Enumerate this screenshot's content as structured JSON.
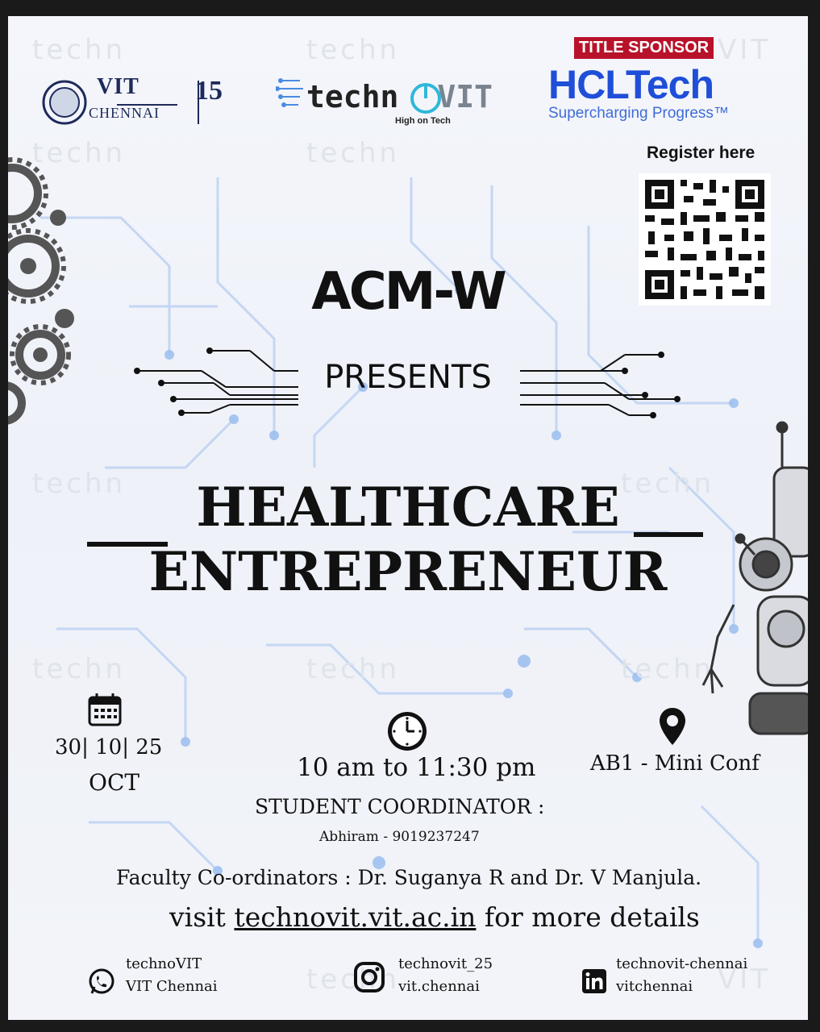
{
  "header": {
    "vit_name": "VIT",
    "vit_city": "CHENNAI",
    "vit_years": "15",
    "techno_brand": "techn",
    "techno_suffix": "VIT",
    "techno_tagline": "High on Tech",
    "watermark_text": "techn",
    "watermark_suffix": "VIT",
    "sponsor_label": "TITLE SPONSOR",
    "sponsor_name": "HCLTech",
    "sponsor_tagline": "Supercharging Progress™",
    "register_label": "Register here"
  },
  "event": {
    "organizer": "ACM-W",
    "presents": "PRESENTS",
    "title_line1": "HEALTHCARE",
    "title_line2": "ENTREPRENEUR"
  },
  "details": {
    "date": "30| 10| 25",
    "month": "OCT",
    "time": "10 am to 11:30 pm",
    "venue": "AB1 - Mini Conf",
    "coordinator_label": "STUDENT COORDINATOR :",
    "coordinator": "Abhiram - 9019237247",
    "faculty": "Faculty Co-ordinators : Dr. Suganya R and Dr. V Manjula.",
    "visit_prefix": "visit ",
    "visit_link": "technovit.vit.ac.in",
    "visit_suffix": " for more details"
  },
  "social": {
    "whatsapp_line1": "technoVIT",
    "whatsapp_line2": "VIT Chennai",
    "instagram_line1": "technovit_25",
    "instagram_line2": "vit.chennai",
    "linkedin_line1": "technovit-chennai",
    "linkedin_line2": "vitchennai"
  },
  "colors": {
    "accent_red": "#b8122a",
    "hcl_blue": "#1f4fd8",
    "circuit_blue": "#a9c4ee"
  },
  "icons": [
    "calendar-icon",
    "clock-icon",
    "location-pin-icon",
    "whatsapp-icon",
    "instagram-icon",
    "linkedin-icon",
    "gear-icon",
    "robot-illustration",
    "qr-code"
  ]
}
